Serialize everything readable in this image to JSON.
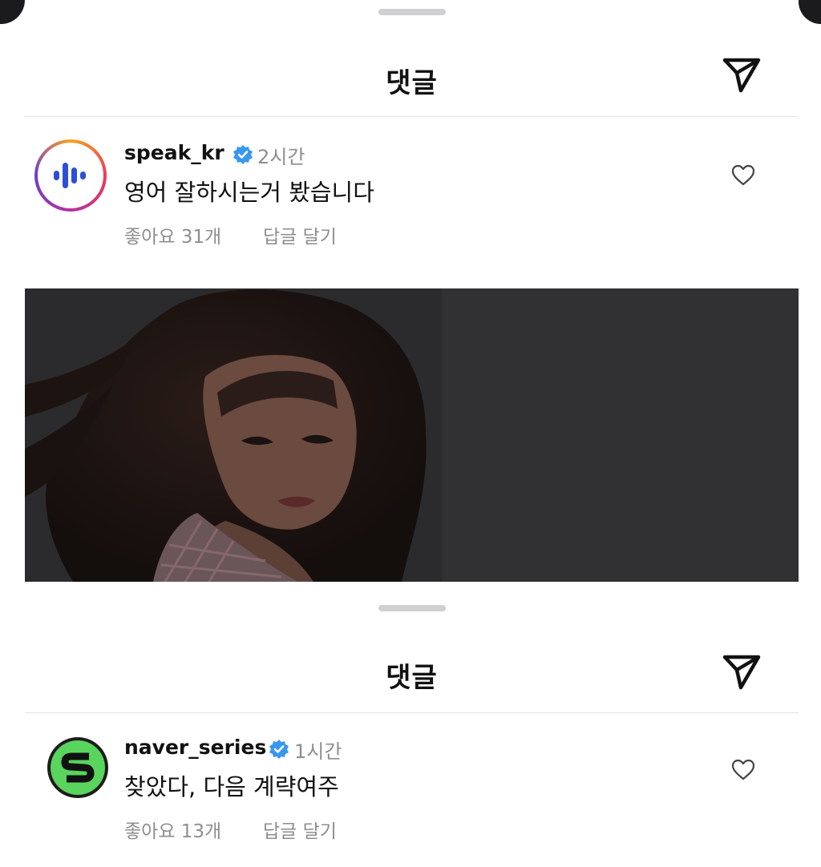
{
  "panels": [
    {
      "title": "댓글",
      "comment": {
        "username": "speak_kr",
        "time": "2시간",
        "text": "영어 잘하시는거 봤습니다",
        "likes": "좋아요 31개",
        "reply": "답글 달기"
      }
    },
    {
      "title": "댓글",
      "comment": {
        "username": "naver_series",
        "time": "1시간",
        "text": "찾았다, 다음 계략여주",
        "likes": "좋아요 13개",
        "reply": "답글 달기"
      }
    }
  ],
  "colors": {
    "verified": "#3897f0",
    "secondary_text": "#8e8e8e",
    "naver_series_green": "#59d45c"
  },
  "icons": {
    "share": "paper-plane-icon",
    "like": "heart-icon",
    "verified": "verified-badge-icon"
  }
}
